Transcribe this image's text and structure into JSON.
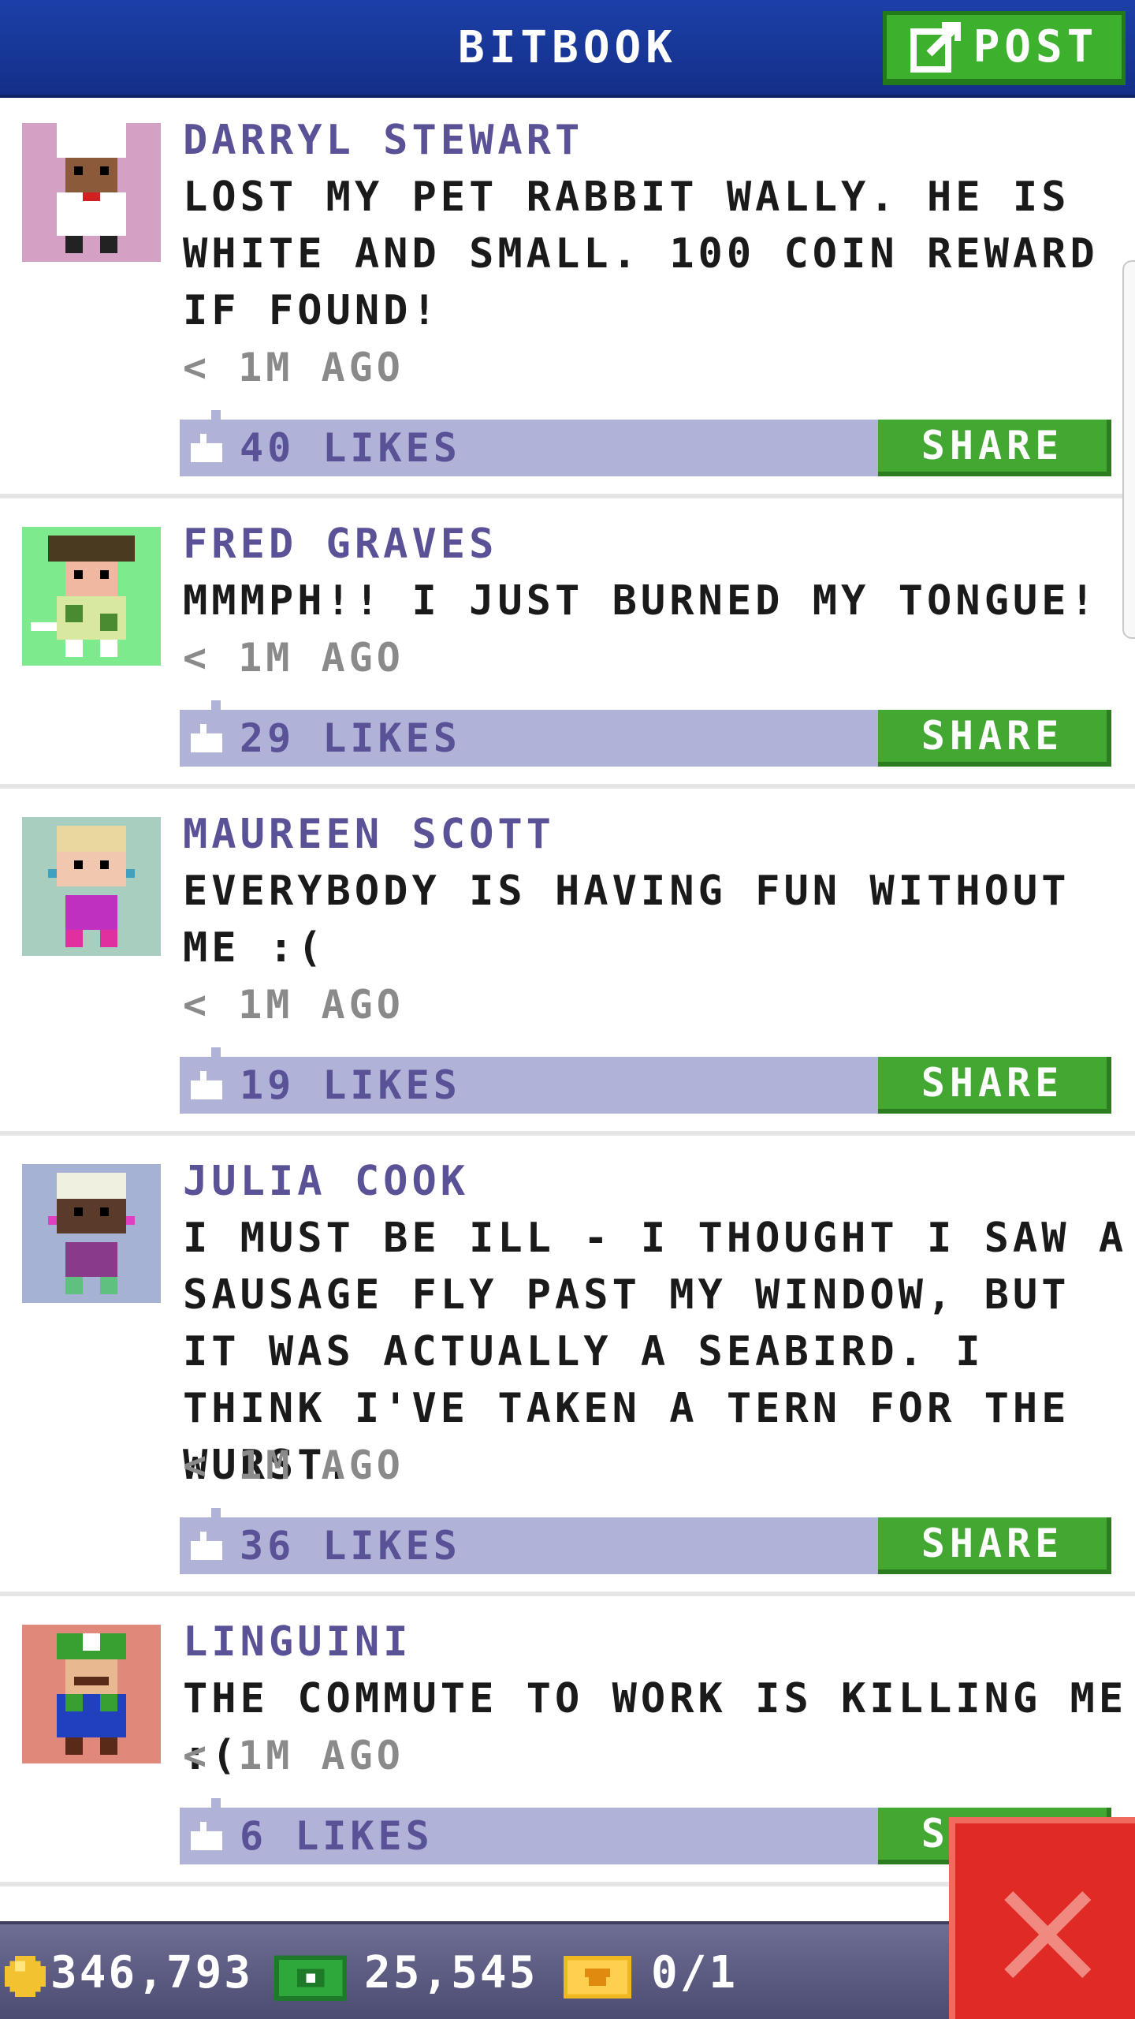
{
  "header": {
    "title": "BITBOOK",
    "post_label": "POST"
  },
  "posts": [
    {
      "name": "DARRYL STEWART",
      "message": "LOST MY PET RABBIT WALLY. HE IS WHITE AND SMALL. 100 COIN REWARD IF FOUND!",
      "time": "< 1M AGO",
      "likes": "40 LIKES",
      "share": "SHARE",
      "avatar_bg": "#d4a0c4"
    },
    {
      "name": "FRED GRAVES",
      "message": "MMMPH!! I JUST BURNED MY TONGUE!",
      "time": "< 1M AGO",
      "likes": "29 LIKES",
      "share": "SHARE",
      "avatar_bg": "#7eea8e"
    },
    {
      "name": "MAUREEN SCOTT",
      "message": "EVERYBODY IS HAVING FUN WITHOUT ME :(",
      "time": "< 1M AGO",
      "likes": "19 LIKES",
      "share": "SHARE",
      "avatar_bg": "#a8cec0"
    },
    {
      "name": "JULIA COOK",
      "message": "I MUST BE ILL - I THOUGHT I SAW A SAUSAGE FLY PAST MY WINDOW, BUT IT WAS ACTUALLY A SEABIRD. I THINK I'VE TAKEN A TERN FOR THE WURST.",
      "time": "< 1M AGO",
      "likes": "36 LIKES",
      "share": "SHARE",
      "avatar_bg": "#a6b2d4"
    },
    {
      "name": "LINGUINI",
      "message": "THE COMMUTE TO WORK IS KILLING ME :(",
      "time": "< 1M AGO",
      "likes": "6 LIKES",
      "share": "SHARE",
      "avatar_bg": "#e0887a"
    }
  ],
  "footer": {
    "coins": "346,793",
    "bux": "25,545",
    "tickets": "0/1"
  },
  "colors": {
    "header_blue": "#1c3fa8",
    "accent_green": "#43a832",
    "likes_bar": "#b1b2d8",
    "name_purple": "#5a5296",
    "close_red": "#e02a26"
  },
  "icons": [
    "edit-icon",
    "like-icon",
    "coin-icon",
    "cash-icon",
    "ticket-icon",
    "close-icon"
  ]
}
